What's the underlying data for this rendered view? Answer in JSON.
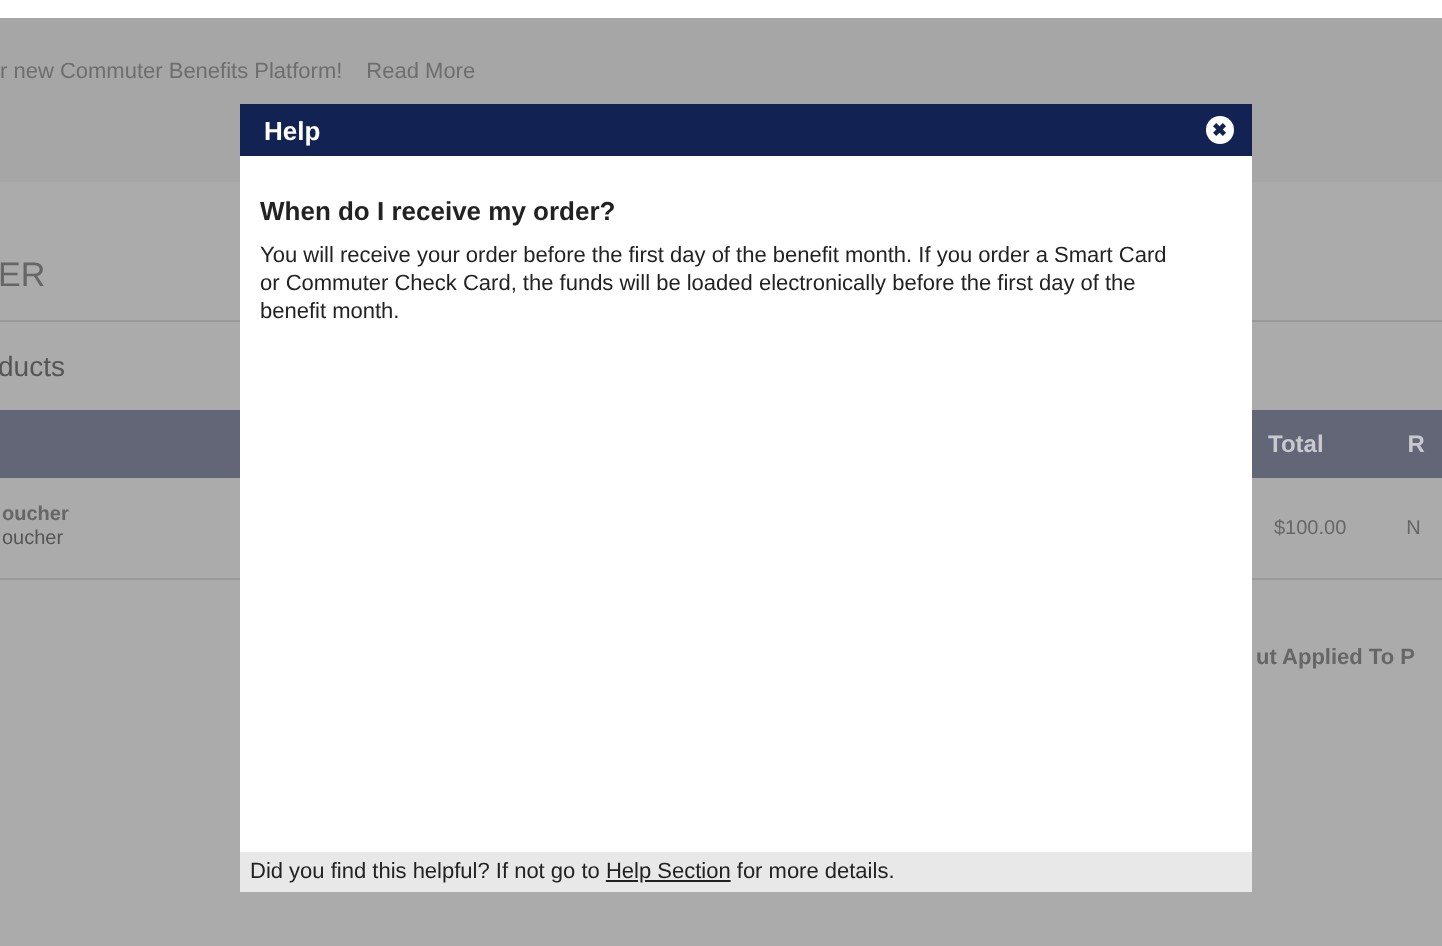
{
  "banner": {
    "text": "r new Commuter Benefits Platform!",
    "link": "Read More"
  },
  "page": {
    "heading": "ER",
    "tab": "ducts",
    "table": {
      "columns": [
        "Total",
        "R"
      ],
      "rows": [
        {
          "item": "oucher",
          "subitem": "oucher",
          "cells": [
            "$100.00",
            "N"
          ]
        }
      ]
    },
    "summary": "ut Applied To P"
  },
  "dialog": {
    "title": "Help",
    "close": "✖",
    "question": "When do I receive my order?",
    "answer": "You will receive your order before the first day of the benefit month. If you order a Smart Card or Commuter Check Card, the funds will be loaded electronically before the first day of the benefit month.",
    "footer": {
      "before": "Did you find this helpful? If not go to",
      "link": "Help Section",
      "after": "for more details."
    }
  }
}
